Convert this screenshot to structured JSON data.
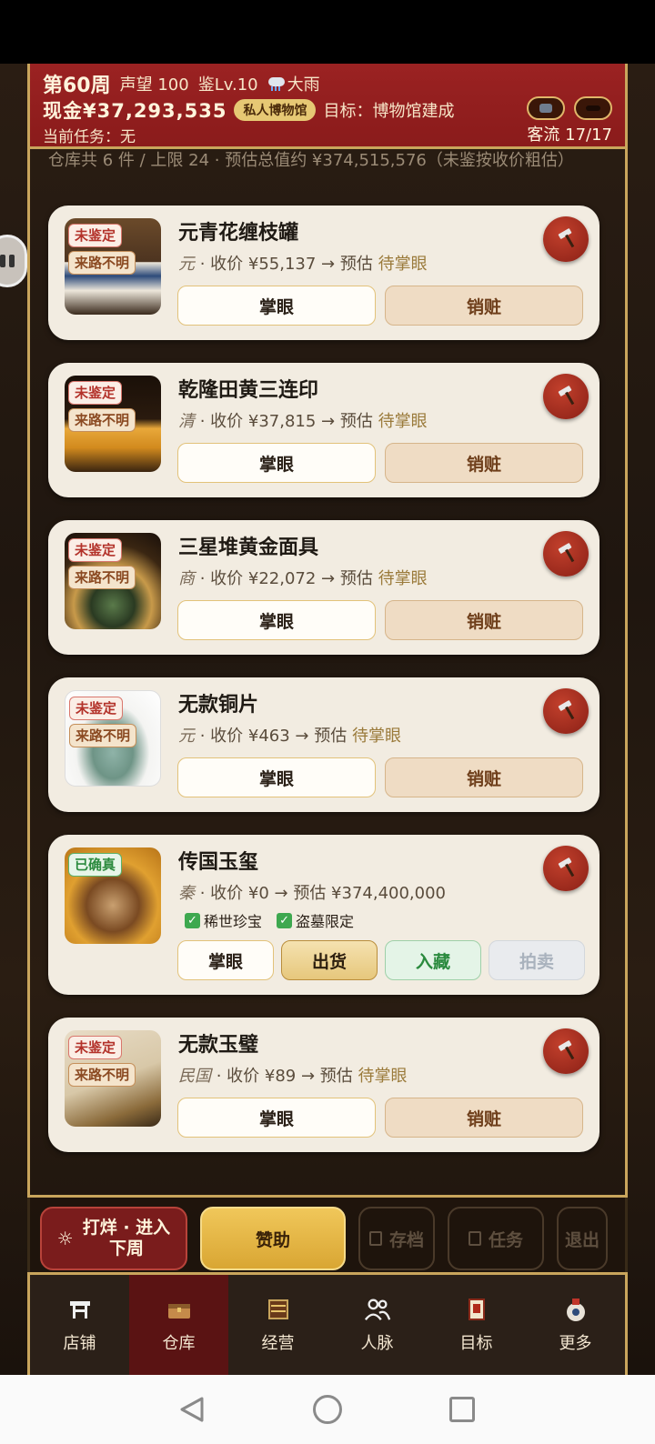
{
  "header": {
    "week": "第60周",
    "reputation": "声望 100",
    "appraisal_level": "鉴Lv.10",
    "weather": "大雨",
    "cash": "现金¥37,293,535",
    "museum_badge": "私人博物馆",
    "goal": "目标：博物馆建成",
    "current_task": "当前任务：无",
    "traffic": "客流 17/17"
  },
  "summary": {
    "text": "仓库共 6 件 / 上限 24  ·  预估总值约 ¥374,515,576（未鉴按收价粗估）"
  },
  "labels": {
    "appraise": "掌眼",
    "destroy": "销赃",
    "sell": "出货",
    "collect": "入藏",
    "auction": "拍卖",
    "unappraised": "未鉴定",
    "unknown_origin": "来路不明",
    "authenticated": "已确真"
  },
  "items": [
    {
      "name": "元青花缠枝罐",
      "dynasty": "元",
      "meta": " · 收价 ¥55,137 → 预估 ",
      "estimate": "待掌眼"
    },
    {
      "name": "乾隆田黄三连印",
      "dynasty": "清",
      "meta": " · 收价 ¥37,815 → 预估 ",
      "estimate": "待掌眼"
    },
    {
      "name": "三星堆黄金面具",
      "dynasty": "商",
      "meta": " · 收价 ¥22,072 → 预估 ",
      "estimate": "待掌眼"
    },
    {
      "name": "无款铜片",
      "dynasty": "元",
      "meta": " · 收价 ¥463 → 预估 ",
      "estimate": "待掌眼"
    },
    {
      "name": "传国玉玺",
      "dynasty": "秦",
      "meta": " · 收价 ¥0 → 预估 ",
      "estimate": "¥374,400,000",
      "checks": [
        "稀世珍宝",
        "盗墓限定"
      ]
    },
    {
      "name": "无款玉璧",
      "dynasty": "民国",
      "meta": " · 收价 ¥89 → 预估 ",
      "estimate": "待掌眼"
    }
  ],
  "actions": {
    "next_week": [
      "打烊 · 进入",
      "下周"
    ],
    "sponsor": "赞助",
    "save": "存档",
    "task": "任务",
    "exit": "退出"
  },
  "tabs": [
    {
      "label": "店铺",
      "icon": "shop-icon"
    },
    {
      "label": "仓库",
      "icon": "warehouse-icon"
    },
    {
      "label": "经营",
      "icon": "abacus-icon"
    },
    {
      "label": "人脉",
      "icon": "people-icon"
    },
    {
      "label": "目标",
      "icon": "scroll-icon"
    },
    {
      "label": "更多",
      "icon": "vase-icon"
    }
  ],
  "active_tab": "仓库",
  "colors": {
    "header_red": "#9b2222",
    "gold_border": "#c9a55c",
    "card_bg": "#f2ece1",
    "sponsor_gold": "#e0b040",
    "authentic_green": "#2b8a3e"
  }
}
